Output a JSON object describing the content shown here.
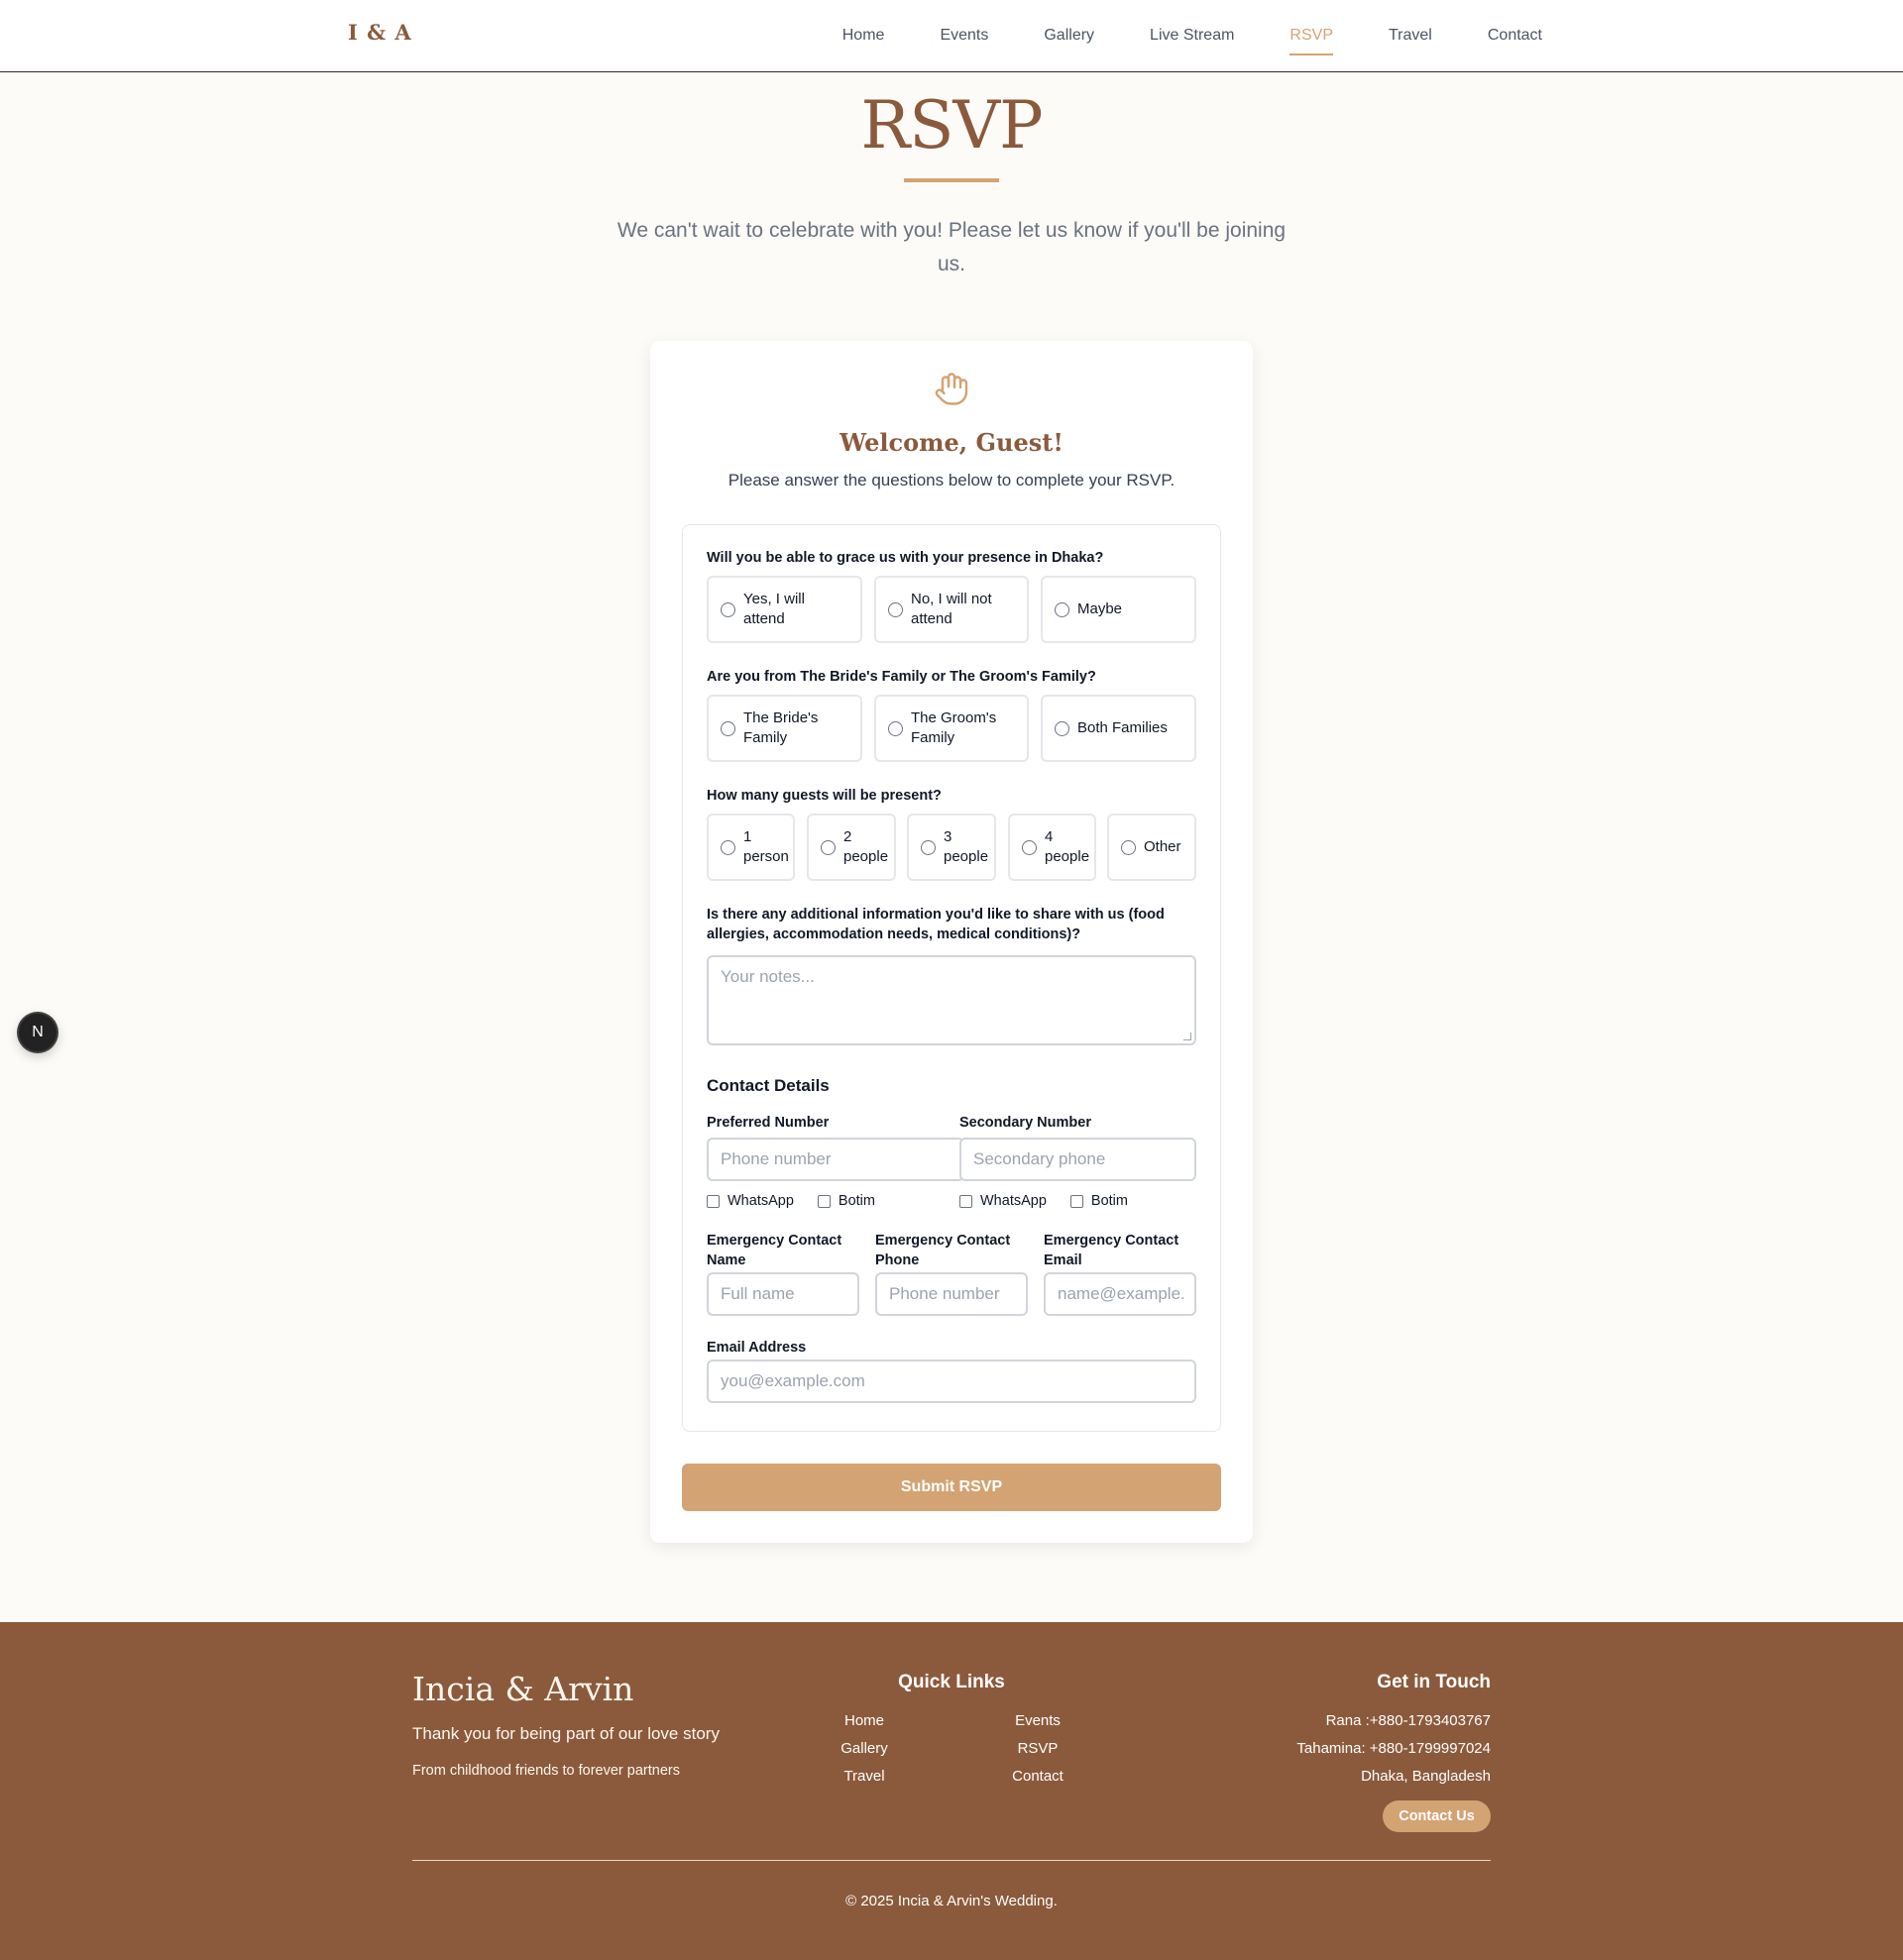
{
  "nav": {
    "logo": "I & A",
    "links": [
      "Home",
      "Events",
      "Gallery",
      "Live Stream",
      "RSVP",
      "Travel",
      "Contact"
    ],
    "active": "RSVP"
  },
  "hero": {
    "title": "RSVP",
    "subtitle": "We can't wait to celebrate with you! Please let us know if you'll be joining us."
  },
  "card": {
    "icon": "hand-icon",
    "welcome": "Welcome, Guest!",
    "instructions": "Please answer the questions below to complete your RSVP.",
    "q_attend": {
      "label": "Will you be able to grace us with your presence in Dhaka?",
      "options": [
        "Yes, I will attend",
        "No, I will not attend",
        "Maybe"
      ]
    },
    "q_family": {
      "label": "Are you from The Bride's Family or The Groom's Family?",
      "options": [
        "The Bride's Family",
        "The Groom's Family",
        "Both Families"
      ]
    },
    "q_guests": {
      "label": "How many guests will be present?",
      "options": [
        "1 person",
        "2 people",
        "3 people",
        "4 people",
        "Other"
      ]
    },
    "q_info": {
      "label": "Is there any additional information you'd like to share with us (food allergies, accommodation needs, medical conditions)?",
      "placeholder": "Your notes..."
    },
    "contact": {
      "title": "Contact Details",
      "preferred_label": "Preferred Number",
      "preferred_placeholder": "Phone number",
      "secondary_label": "Secondary Number",
      "secondary_placeholder": "Secondary phone",
      "whatsapp": "WhatsApp",
      "botim": "Botim",
      "emergency_name_label": "Emergency Contact Name",
      "emergency_name_placeholder": "Full name",
      "emergency_phone_label": "Emergency Contact Phone",
      "emergency_phone_placeholder": "Phone number",
      "emergency_email_label": "Emergency Contact Email",
      "emergency_email_placeholder": "name@example.",
      "email_label": "Email Address",
      "email_placeholder": "you@example.com"
    },
    "submit": "Submit RSVP"
  },
  "badge": "N",
  "footer": {
    "brand": "Incia & Arvin",
    "tagline": "Thank you for being part of our love story",
    "story": "From childhood friends to forever partners",
    "quick_links_title": "Quick Links",
    "quick_links": [
      "Home",
      "Events",
      "Gallery",
      "RSVP",
      "Travel",
      "Contact"
    ],
    "get_in_touch_title": "Get in Touch",
    "contacts": [
      "Rana :+880-1793403767",
      "Tahamina: +880-1799997024",
      "Dhaka, Bangladesh"
    ],
    "contact_button": "Contact Us",
    "copyright": "© 2025 Incia & Arvin's Wedding."
  },
  "colors": {
    "accent": "#d4a373",
    "brand": "#8b5a3c",
    "background": "#fcfbf7"
  }
}
